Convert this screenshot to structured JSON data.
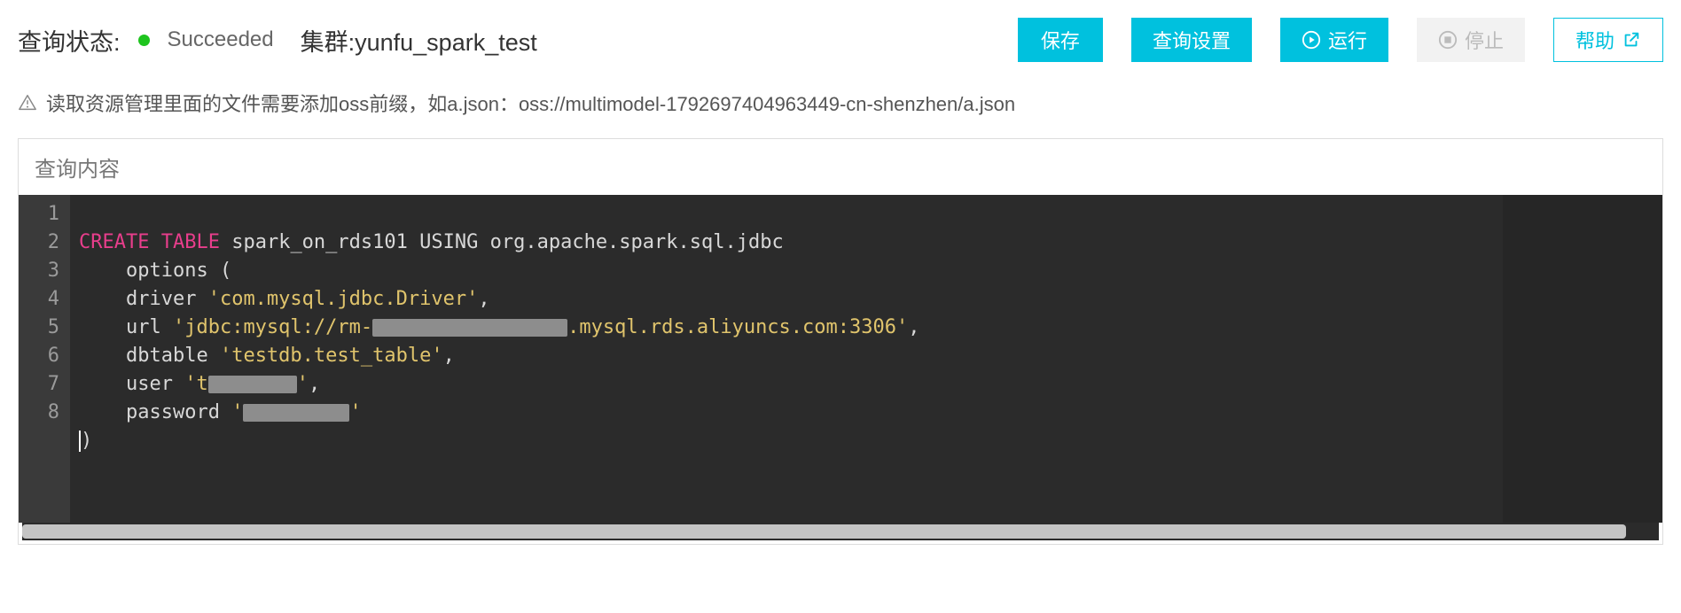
{
  "header": {
    "status_label": "查询状态:",
    "status_value": "Succeeded",
    "status_color": "#1ec41e",
    "cluster_label": "集群:yunfu_spark_test"
  },
  "buttons": {
    "save": "保存",
    "query_settings": "查询设置",
    "run": "运行",
    "stop": "停止",
    "help": "帮助"
  },
  "notice": {
    "text": "读取资源管理里面的文件需要添加oss前缀，如a.json：oss://multimodel-1792697404963449-cn-shenzhen/a.json"
  },
  "editor": {
    "title": "查询内容",
    "line_numbers": [
      "1",
      "2",
      "3",
      "4",
      "5",
      "6",
      "7",
      "8"
    ],
    "code": {
      "l1_kw1": "CREATE",
      "l1_kw2": "TABLE",
      "l1_rest": " spark_on_rds101 USING org.apache.spark.sql.jdbc",
      "l2": "    options (",
      "l3_a": "    driver ",
      "l3_str": "'com.mysql.jdbc.Driver'",
      "l3_b": ",",
      "l4_a": "    url ",
      "l4_str_a": "'jdbc:mysql://rm-",
      "l4_str_b": ".mysql.rds.aliyuncs.com:3306'",
      "l4_c": ",",
      "l5_a": "    dbtable ",
      "l5_str": "'testdb.test_table'",
      "l5_b": ",",
      "l6_a": "    user ",
      "l6_str_a": "'t",
      "l6_str_b": "'",
      "l6_c": ",",
      "l7_a": "    password ",
      "l7_str_a": "'",
      "l7_str_b": "'",
      "l8": ")"
    }
  }
}
